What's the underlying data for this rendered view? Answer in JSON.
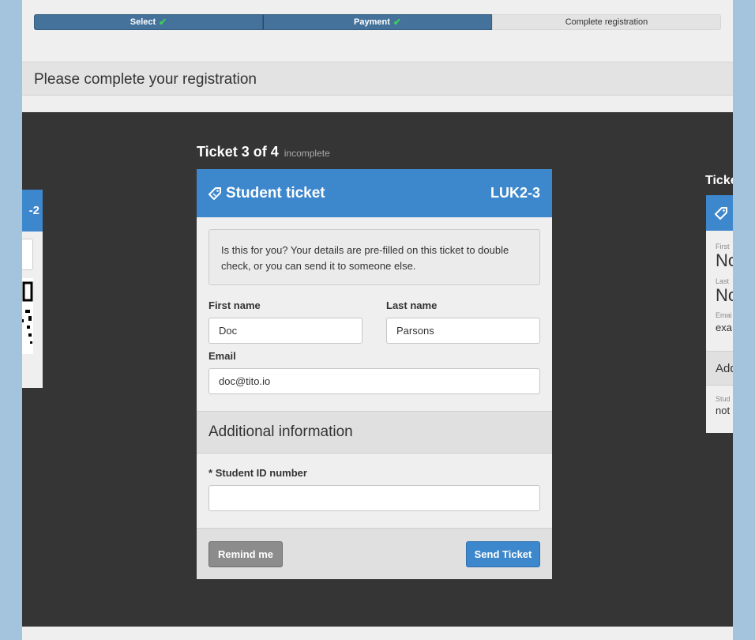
{
  "progress": {
    "steps": [
      {
        "label": "Select",
        "state": "done"
      },
      {
        "label": "Payment",
        "state": "done"
      },
      {
        "label": "Complete registration",
        "state": "current"
      }
    ],
    "check_glyph": "✔"
  },
  "page_title": "Please complete your registration",
  "ticket": {
    "heading": "Ticket 3 of 4",
    "status": "incomplete",
    "name": "Student ticket",
    "reference": "LUK2-3",
    "notice": "Is this for you? Your details are pre-filled on this ticket to double check, or you can send it to someone else.",
    "fields": {
      "first_name": {
        "label": "First name",
        "value": "Doc"
      },
      "last_name": {
        "label": "Last name",
        "value": "Parsons"
      },
      "email": {
        "label": "Email",
        "value": "doc@tito.io"
      }
    },
    "additional": {
      "title": "Additional information",
      "required_marker": "*",
      "student_id_label": "Student ID number",
      "student_id_value": ""
    },
    "buttons": {
      "remind": "Remind me",
      "send": "Send Ticket"
    }
  },
  "left_ticket": {
    "reference_fragment": "-2"
  },
  "right_ticket": {
    "heading_fragment": "Ticke",
    "first_label": "First",
    "first_value": "No",
    "last_label": "Last",
    "last_value": "No",
    "email_label": "Emai",
    "email_value": "exa",
    "additional_fragment": "Add",
    "student_label": "Stud",
    "student_value": "not"
  },
  "colors": {
    "accent": "#3d87cc",
    "progress_done": "#44729b",
    "stage": "#353535",
    "check": "#3fd15a"
  },
  "icons": {
    "ticket": "tag-icon",
    "check": "check-icon"
  }
}
